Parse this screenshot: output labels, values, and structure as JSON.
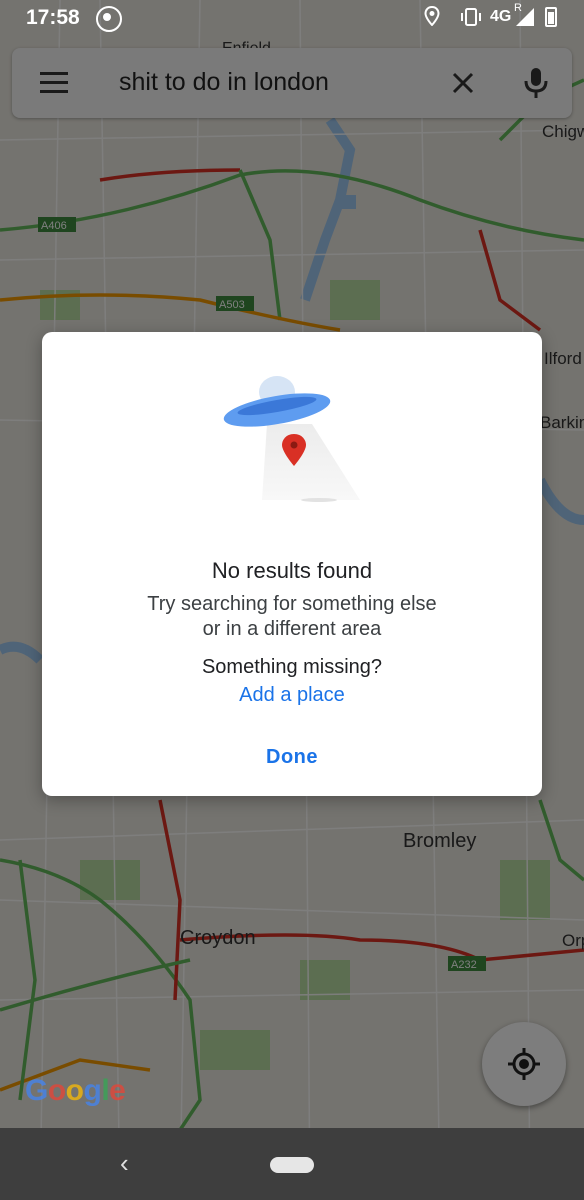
{
  "status_bar": {
    "time": "17:58",
    "network": "4G",
    "roaming": "R",
    "icons": [
      "whatsapp-icon",
      "location-icon",
      "vibrate-icon",
      "signal-icon",
      "battery-icon"
    ]
  },
  "search": {
    "query": "shit to do in london",
    "icons": [
      "menu-icon",
      "close-icon",
      "mic-icon"
    ]
  },
  "map": {
    "labels": [
      {
        "text": "Enfield"
      },
      {
        "text": "Chigw"
      },
      {
        "text": "A406"
      },
      {
        "text": "A503"
      },
      {
        "text": "Ilford"
      },
      {
        "text": "Barkin"
      },
      {
        "text": "Bromley"
      },
      {
        "text": "Croydon"
      },
      {
        "text": "Orp"
      },
      {
        "text": "A232"
      }
    ],
    "logo": "Google",
    "colors": {
      "base": "#e9e6df",
      "road_green": "#63b95a",
      "road_red": "#d93025",
      "road_orange": "#f29900",
      "water": "#9ec8f0",
      "park": "#b9dca3"
    }
  },
  "dialog": {
    "title": "No results found",
    "message_line1": "Try searching for something else",
    "message_line2": "or in a different area",
    "missing_label": "Something missing?",
    "add_place": "Add a place",
    "done": "Done",
    "accent_color": "#1a73e8"
  },
  "locate_button": {
    "icon": "my-location-icon"
  },
  "nav_bar": {
    "icons": [
      "back-icon",
      "home-pill"
    ]
  }
}
